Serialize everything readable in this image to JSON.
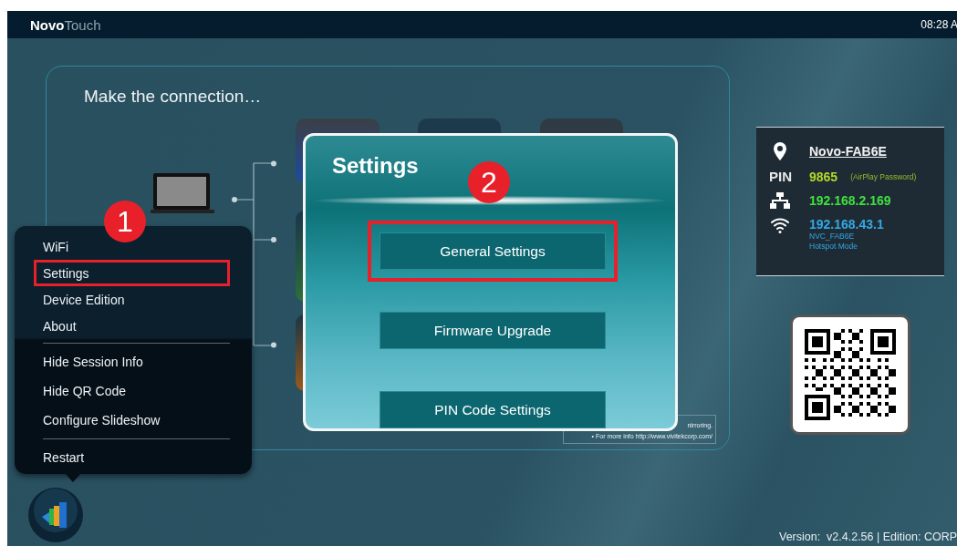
{
  "top_bar": {
    "logo_bold": "Novo",
    "logo_light": "Touch",
    "time": "08:28 A"
  },
  "connection_panel": {
    "title": "Make the connection…",
    "note_lines": [
      "nirroring.",
      "• For more info http://www.vivitekcorp.com/"
    ]
  },
  "menu": {
    "groups": [
      [
        {
          "label": "WiFi",
          "highlighted": false
        },
        {
          "label": "Settings",
          "highlighted": true
        },
        {
          "label": "Device Edition",
          "highlighted": false
        },
        {
          "label": "About",
          "highlighted": false
        }
      ],
      [
        {
          "label": "Hide Session Info",
          "highlighted": false
        },
        {
          "label": "Hide QR Code",
          "highlighted": false
        },
        {
          "label": "Configure Slideshow",
          "highlighted": false
        }
      ],
      [
        {
          "label": "Restart",
          "highlighted": false
        }
      ]
    ]
  },
  "settings_dialog": {
    "title": "Settings",
    "buttons": [
      {
        "label": "General Settings",
        "highlighted": true
      },
      {
        "label": "Firmware Upgrade",
        "highlighted": false
      },
      {
        "label": "PIN Code Settings",
        "highlighted": false
      }
    ]
  },
  "step_badges": [
    {
      "label": "1"
    },
    {
      "label": "2"
    }
  ],
  "session_info": {
    "device_name": "Novo-FAB6E",
    "pin_label": "PIN",
    "pin": "9865",
    "pin_note": "(AirPlay Password)",
    "lan_ip": "192.168.2.169",
    "wifi_ip": "192.168.43.1",
    "ssid": "NVC_FAB6E",
    "wifi_mode": "Hotspot Mode"
  },
  "version": "Version:  v2.4.2.56 | Edition: CORP"
}
